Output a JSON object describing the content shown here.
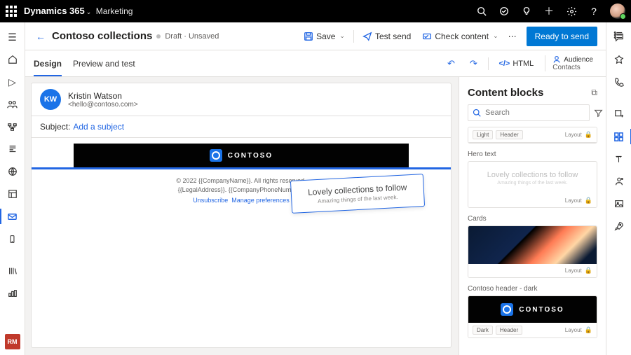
{
  "suite": {
    "brand": "Dynamics 365",
    "module": "Marketing"
  },
  "page": {
    "title": "Contoso collections",
    "status": "Draft · Unsaved"
  },
  "commands": {
    "save": "Save",
    "test_send": "Test send",
    "check_content": "Check content",
    "ready": "Ready to send"
  },
  "tabs": {
    "design": "Design",
    "preview": "Preview and test",
    "html": "HTML",
    "audience_l1": "Audience",
    "audience_l2": "Contacts"
  },
  "sender": {
    "initials": "KW",
    "name": "Kristin Watson",
    "email": "<hello@contoso.com>"
  },
  "subject": {
    "label": "Subject:",
    "link": "Add a subject"
  },
  "email": {
    "brand": "CONTOSO",
    "footer_line1": "© 2022 {{CompanyName}}. All rights reserved.",
    "footer_line2": "{{LegalAddress}}. {{CompanyPhoneNumber}}",
    "unsubscribe": "Unsubscribe",
    "manage": "Manage preferences"
  },
  "floating": {
    "title": "Lovely collections to follow",
    "sub": "Amazing things of the last week."
  },
  "panel": {
    "title": "Content blocks",
    "search_placeholder": "Search",
    "layout_label": "Layout",
    "blocks": [
      {
        "section": "",
        "tags": [
          "Light",
          "Header"
        ],
        "preview_title": "",
        "preview_sub": "",
        "style": "top-meta"
      },
      {
        "section": "Hero text",
        "tags": [],
        "preview_title": "Lovely collections to follow",
        "preview_sub": "Amazing things of the last week.",
        "style": ""
      },
      {
        "section": "Cards",
        "tags": [],
        "preview_title": "",
        "preview_sub": "",
        "style": "image"
      },
      {
        "section": "Contoso header - dark",
        "tags": [
          "Dark",
          "Header"
        ],
        "preview_title": "CONTOSO",
        "preview_sub": "",
        "style": "dark"
      }
    ]
  },
  "left_user": "RM"
}
